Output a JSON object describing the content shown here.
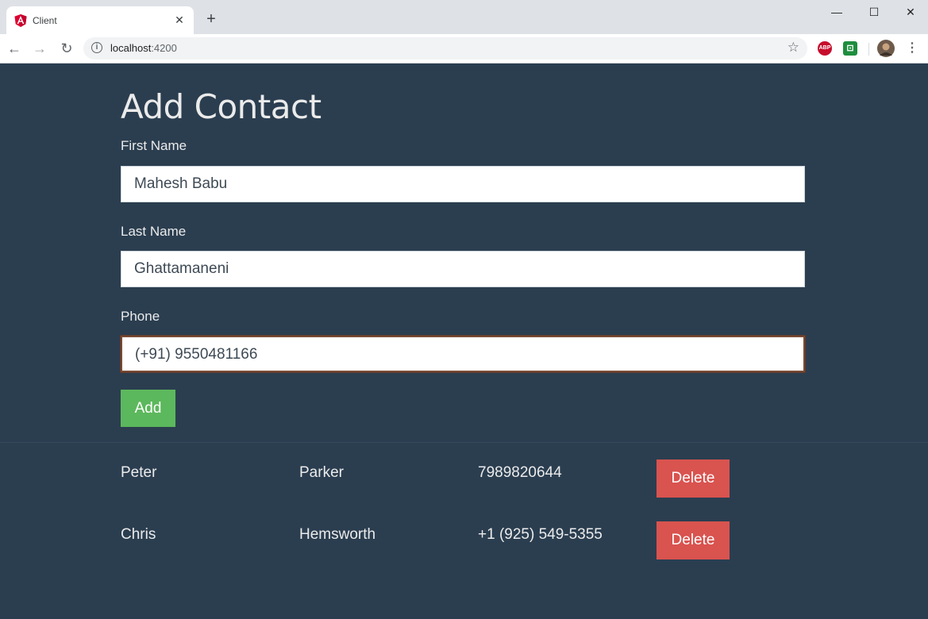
{
  "browser": {
    "tab_title": "Client",
    "tab_close": "✕",
    "new_tab": "+",
    "url_host": "localhost",
    "url_port": ":4200",
    "window_controls": {
      "minimize": "—",
      "maximize": "☐",
      "close": "✕"
    },
    "nav": {
      "back": "←",
      "forward": "→",
      "reload": "↻"
    },
    "extensions": [
      {
        "name": "adblock-plus-icon",
        "label": "ABP",
        "color": "#c70d2c"
      },
      {
        "name": "extension-icon",
        "label": "⊡",
        "color": "#1e8e3e"
      }
    ]
  },
  "form": {
    "title": "Add Contact",
    "first_name_label": "First Name",
    "first_name_value": "Mahesh Babu",
    "last_name_label": "Last Name",
    "last_name_value": "Ghattamaneni",
    "phone_label": "Phone",
    "phone_value": "(+91) 9550481166",
    "add_label": "Add"
  },
  "contacts": [
    {
      "first": "Peter",
      "last": "Parker",
      "phone": "7989820644",
      "delete_label": "Delete"
    },
    {
      "first": "Chris",
      "last": "Hemsworth",
      "phone": "+1 (925) 549-5355",
      "delete_label": "Delete"
    }
  ],
  "colors": {
    "background": "#2b3e50",
    "add": "#5cb85c",
    "delete": "#d9534f"
  }
}
